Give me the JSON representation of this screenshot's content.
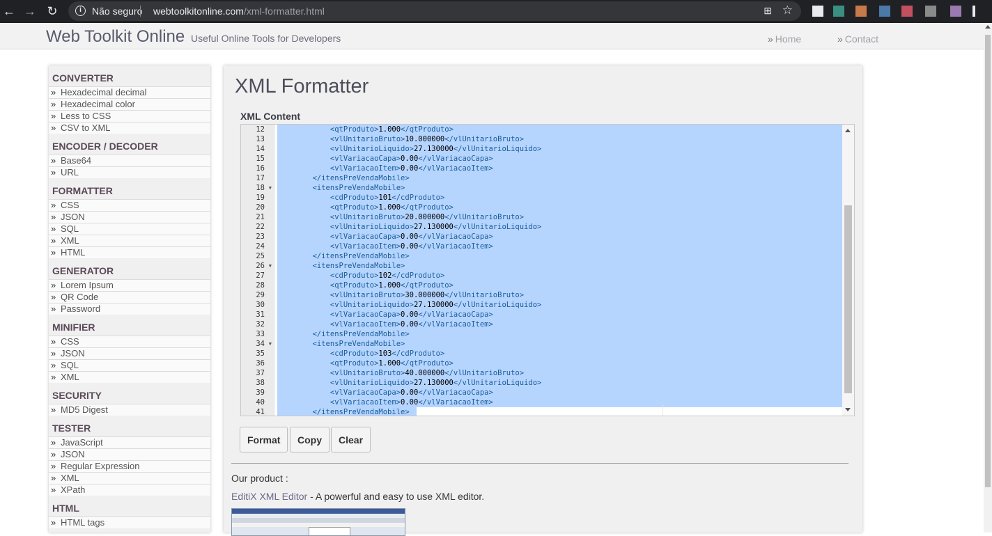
{
  "browser": {
    "security": "Não seguro",
    "url_host": "webtoolkitonline.com",
    "url_path": "/xml-formatter.html"
  },
  "site": {
    "title": "Web Toolkit Online",
    "tagline": "Useful Online Tools for Developers",
    "nav": [
      {
        "label": "Home"
      },
      {
        "label": "Contact"
      }
    ],
    "raquo": "»"
  },
  "sidebar": {
    "groups": [
      {
        "heading": "CONVERTER",
        "items": [
          "Hexadecimal decimal",
          "Hexadecimal color",
          "Less to CSS",
          "CSV to XML"
        ]
      },
      {
        "heading": "ENCODER / DECODER",
        "items": [
          "Base64",
          "URL"
        ]
      },
      {
        "heading": "FORMATTER",
        "items": [
          "CSS",
          "JSON",
          "SQL",
          "XML",
          "HTML"
        ]
      },
      {
        "heading": "GENERATOR",
        "items": [
          "Lorem Ipsum",
          "QR Code",
          "Password"
        ]
      },
      {
        "heading": "MINIFIER",
        "items": [
          "CSS",
          "JSON",
          "SQL",
          "XML"
        ]
      },
      {
        "heading": "SECURITY",
        "items": [
          "MD5 Digest"
        ]
      },
      {
        "heading": "TESTER",
        "items": [
          "JavaScript",
          "JSON",
          "Regular Expression",
          "XML",
          "XPath"
        ]
      },
      {
        "heading": "HTML",
        "items": [
          "HTML tags"
        ]
      }
    ]
  },
  "main": {
    "title": "XML Formatter",
    "xml_label": "XML Content",
    "code_lines": [
      {
        "n": "12",
        "fold": false,
        "indent": 3,
        "tag": "qtProduto",
        "value": "1.000"
      },
      {
        "n": "13",
        "fold": false,
        "indent": 3,
        "tag": "vlUnitarioBruto",
        "value": "10.000000"
      },
      {
        "n": "14",
        "fold": false,
        "indent": 3,
        "tag": "vlUnitarioLiquido",
        "value": "27.130000"
      },
      {
        "n": "15",
        "fold": false,
        "indent": 3,
        "tag": "vlVariacaoCapa",
        "value": "0.00"
      },
      {
        "n": "16",
        "fold": false,
        "indent": 3,
        "tag": "vlVariacaoItem",
        "value": "0.00"
      },
      {
        "n": "17",
        "fold": false,
        "indent": 2,
        "close": "itensPreVendaMobile"
      },
      {
        "n": "18",
        "fold": true,
        "indent": 2,
        "open": "itensPreVendaMobile"
      },
      {
        "n": "19",
        "fold": false,
        "indent": 3,
        "tag": "cdProduto",
        "value": "101"
      },
      {
        "n": "20",
        "fold": false,
        "indent": 3,
        "tag": "qtProduto",
        "value": "1.000"
      },
      {
        "n": "21",
        "fold": false,
        "indent": 3,
        "tag": "vlUnitarioBruto",
        "value": "20.000000"
      },
      {
        "n": "22",
        "fold": false,
        "indent": 3,
        "tag": "vlUnitarioLiquido",
        "value": "27.130000"
      },
      {
        "n": "23",
        "fold": false,
        "indent": 3,
        "tag": "vlVariacaoCapa",
        "value": "0.00"
      },
      {
        "n": "24",
        "fold": false,
        "indent": 3,
        "tag": "vlVariacaoItem",
        "value": "0.00"
      },
      {
        "n": "25",
        "fold": false,
        "indent": 2,
        "close": "itensPreVendaMobile"
      },
      {
        "n": "26",
        "fold": true,
        "indent": 2,
        "open": "itensPreVendaMobile"
      },
      {
        "n": "27",
        "fold": false,
        "indent": 3,
        "tag": "cdProduto",
        "value": "102"
      },
      {
        "n": "28",
        "fold": false,
        "indent": 3,
        "tag": "qtProduto",
        "value": "1.000"
      },
      {
        "n": "29",
        "fold": false,
        "indent": 3,
        "tag": "vlUnitarioBruto",
        "value": "30.000000"
      },
      {
        "n": "30",
        "fold": false,
        "indent": 3,
        "tag": "vlUnitarioLiquido",
        "value": "27.130000"
      },
      {
        "n": "31",
        "fold": false,
        "indent": 3,
        "tag": "vlVariacaoCapa",
        "value": "0.00"
      },
      {
        "n": "32",
        "fold": false,
        "indent": 3,
        "tag": "vlVariacaoItem",
        "value": "0.00"
      },
      {
        "n": "33",
        "fold": false,
        "indent": 2,
        "close": "itensPreVendaMobile"
      },
      {
        "n": "34",
        "fold": true,
        "indent": 2,
        "open": "itensPreVendaMobile"
      },
      {
        "n": "35",
        "fold": false,
        "indent": 3,
        "tag": "cdProduto",
        "value": "103"
      },
      {
        "n": "36",
        "fold": false,
        "indent": 3,
        "tag": "qtProduto",
        "value": "1.000"
      },
      {
        "n": "37",
        "fold": false,
        "indent": 3,
        "tag": "vlUnitarioBruto",
        "value": "40.000000"
      },
      {
        "n": "38",
        "fold": false,
        "indent": 3,
        "tag": "vlUnitarioLiquido",
        "value": "27.130000"
      },
      {
        "n": "39",
        "fold": false,
        "indent": 3,
        "tag": "vlVariacaoCapa",
        "value": "0.00"
      },
      {
        "n": "40",
        "fold": false,
        "indent": 3,
        "tag": "vlVariacaoItem",
        "value": "0.00"
      },
      {
        "n": "41",
        "fold": false,
        "indent": 2,
        "close": "itensPreVendaMobile"
      }
    ],
    "buttons": {
      "format": "Format",
      "copy": "Copy",
      "clear": "Clear"
    },
    "our_product": "Our product :",
    "product_link": "EditiX XML Editor",
    "product_desc": " - A powerful and easy to use XML editor."
  },
  "colors": {
    "selection": "#b5d5ff",
    "xml_tag": "#1a5c9b",
    "heading": "#5a4a58"
  }
}
